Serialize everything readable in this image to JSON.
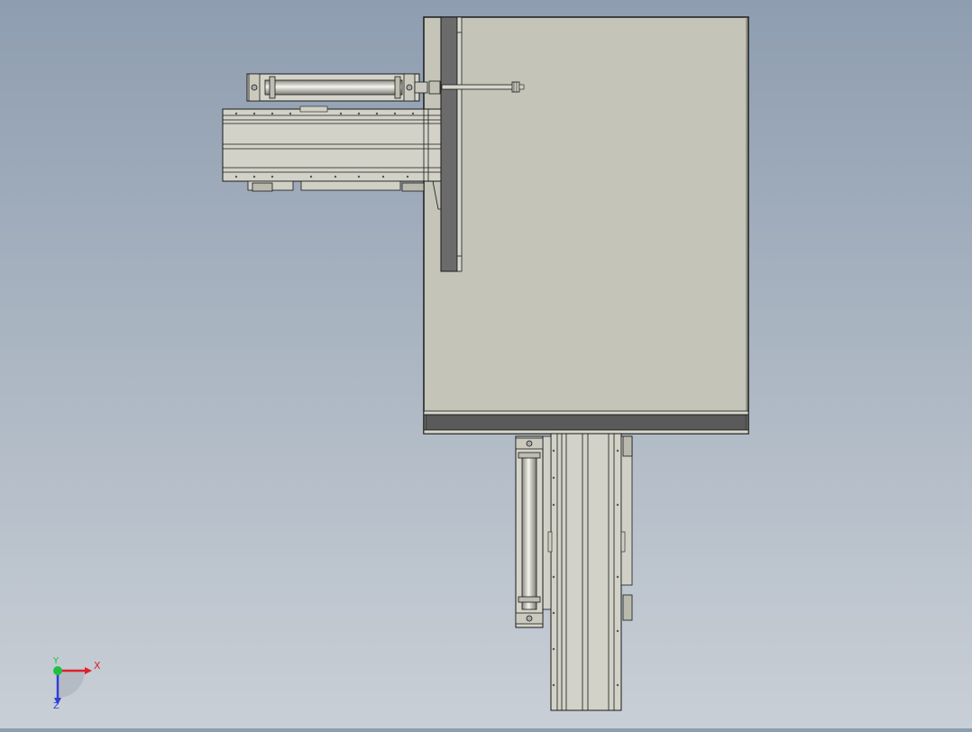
{
  "viewport": {
    "background_top": "#8e9db0",
    "background_bottom": "#c9cfd6"
  },
  "triad": {
    "x_label": "X",
    "y_label": "Y",
    "z_label": "Z",
    "x_color": "#e0202a",
    "y_color": "#20c040",
    "z_color": "#2f3fd8"
  },
  "colors": {
    "panel_fill": "#c4c4b8",
    "dark_plate": "#6b6b6b",
    "dark_bar": "#5a5a5a",
    "rail_fill": "#d2d2c8",
    "line": "#1a1a1a"
  }
}
